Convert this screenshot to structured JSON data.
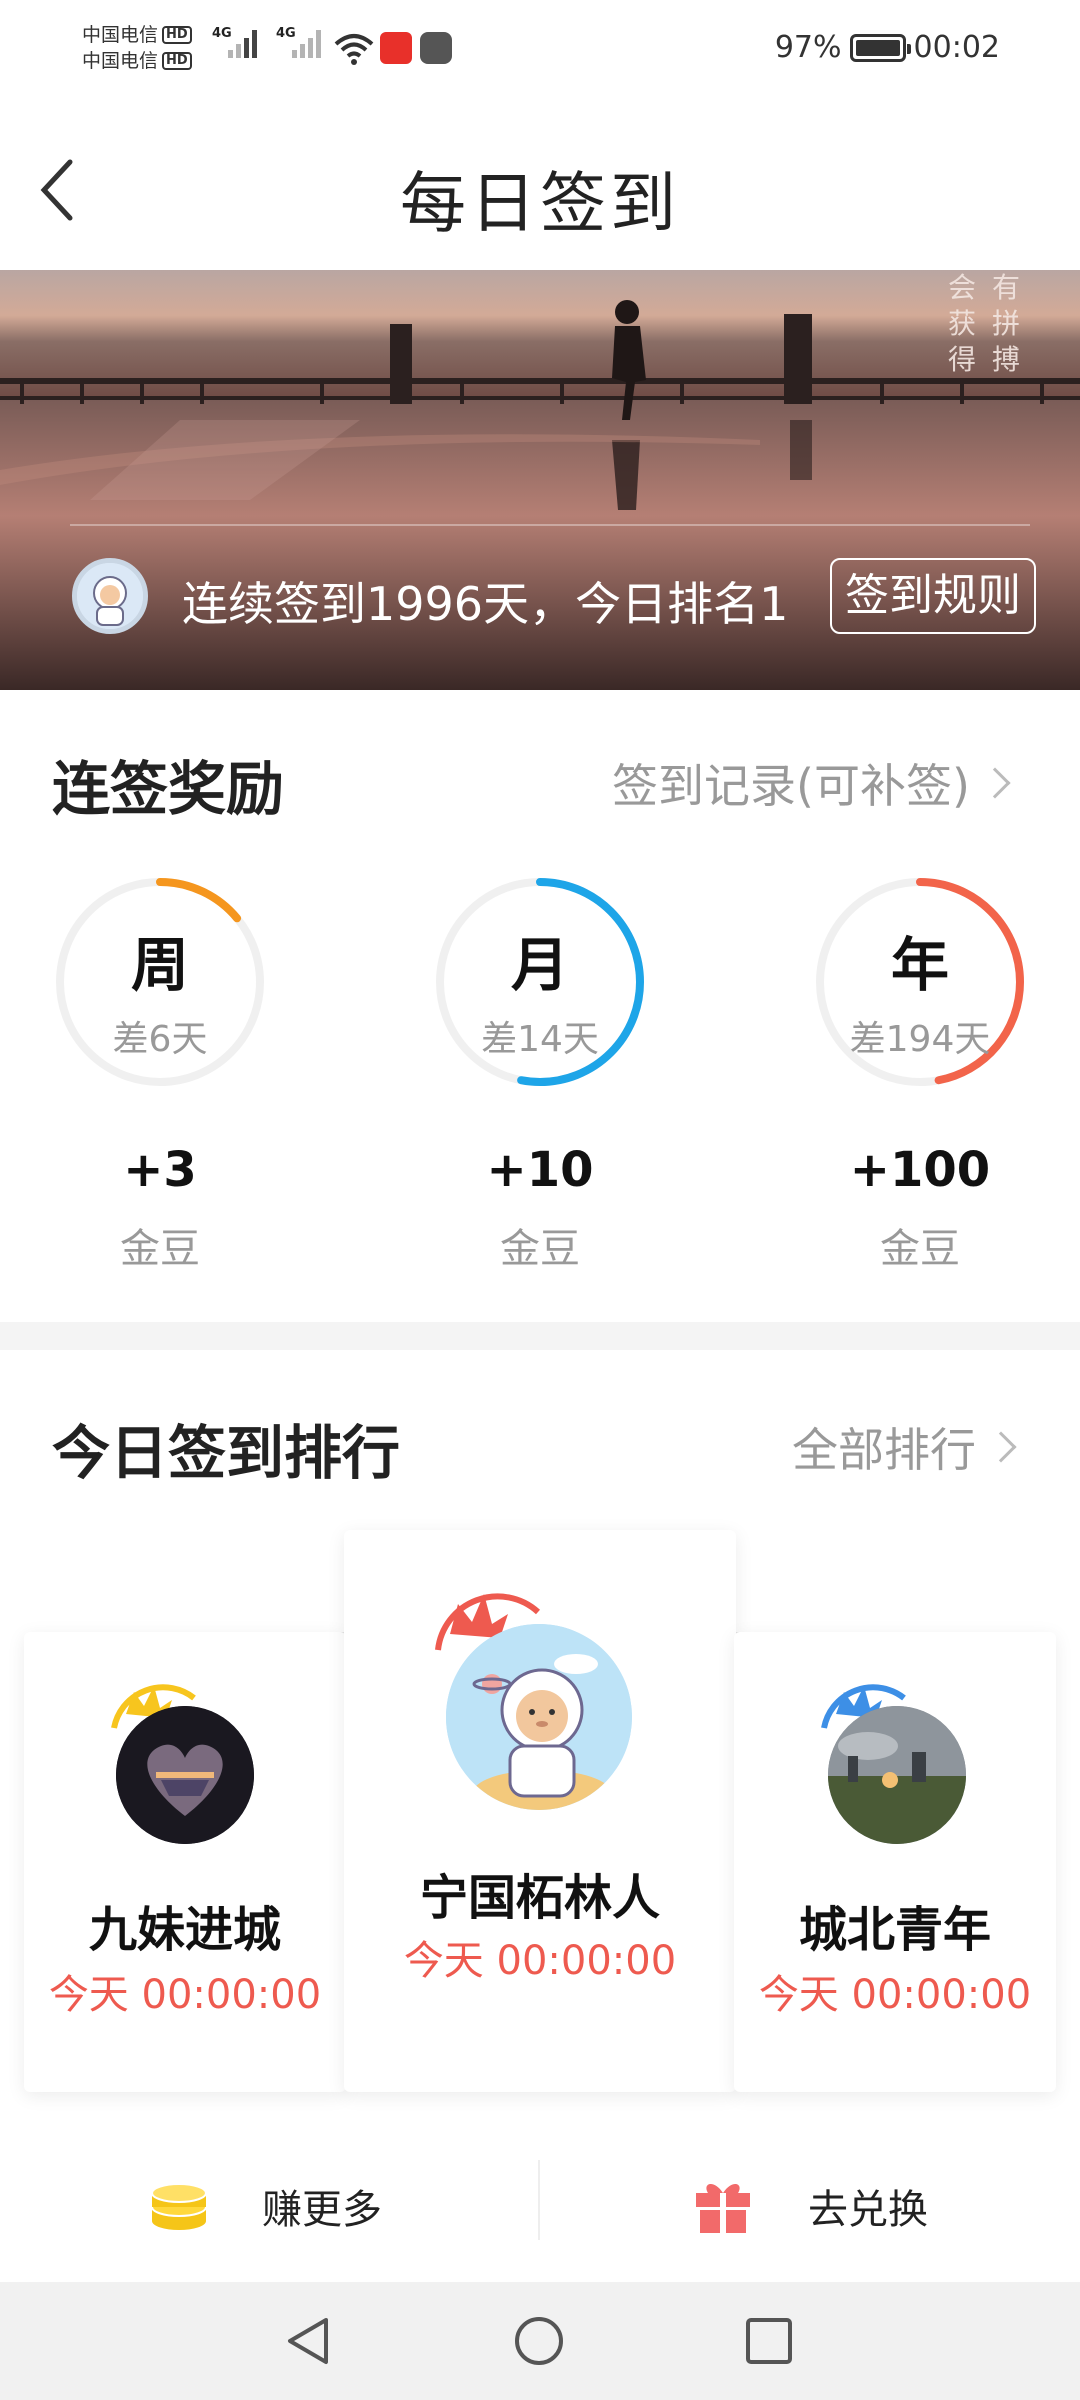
{
  "status_bar": {
    "carrier1": "中国电信",
    "carrier2": "中国电信",
    "hd": "HD",
    "net1": "4G",
    "net2": "4G",
    "battery": "97%",
    "time": "00:02"
  },
  "header": {
    "title": "每日签到"
  },
  "banner": {
    "vertical_text_left": "会获得",
    "vertical_text_right": "有拼搏",
    "streak_text": "连续签到1996天，今日排名1",
    "rules_button": "签到规则"
  },
  "streak_rewards": {
    "title": "连签奖励",
    "record_link": "签到记录(可补签)",
    "items": [
      {
        "label": "周",
        "remaining": "差6天",
        "bonus": "+3",
        "unit": "金豆",
        "color": "#f5961e",
        "progress": 0.14
      },
      {
        "label": "月",
        "remaining": "差14天",
        "bonus": "+10",
        "unit": "金豆",
        "color": "#1ea5e8",
        "progress": 0.53
      },
      {
        "label": "年",
        "remaining": "差194天",
        "bonus": "+100",
        "unit": "金豆",
        "color": "#f2644a",
        "progress": 0.47
      }
    ]
  },
  "ranking": {
    "title": "今日签到排行",
    "all_link": "全部排行",
    "entries": [
      {
        "rank": 2,
        "name": "九妹进城",
        "time": "今天 00:00:00",
        "crown_color": "#f7c51e"
      },
      {
        "rank": 1,
        "name": "宁国柘林人",
        "time": "今天 00:00:00",
        "crown_color": "#ee5a4f"
      },
      {
        "rank": 3,
        "name": "城北青年",
        "time": "今天 00:00:00",
        "crown_color": "#3d8fe6"
      }
    ]
  },
  "bottom_bar": {
    "earn_label": "赚更多",
    "exchange_label": "去兑换",
    "earn_icon": "coins-icon",
    "exchange_icon": "gift-icon"
  },
  "nav_bar": {
    "icons": [
      "back-triangle-icon",
      "home-circle-icon",
      "recents-square-icon"
    ]
  }
}
